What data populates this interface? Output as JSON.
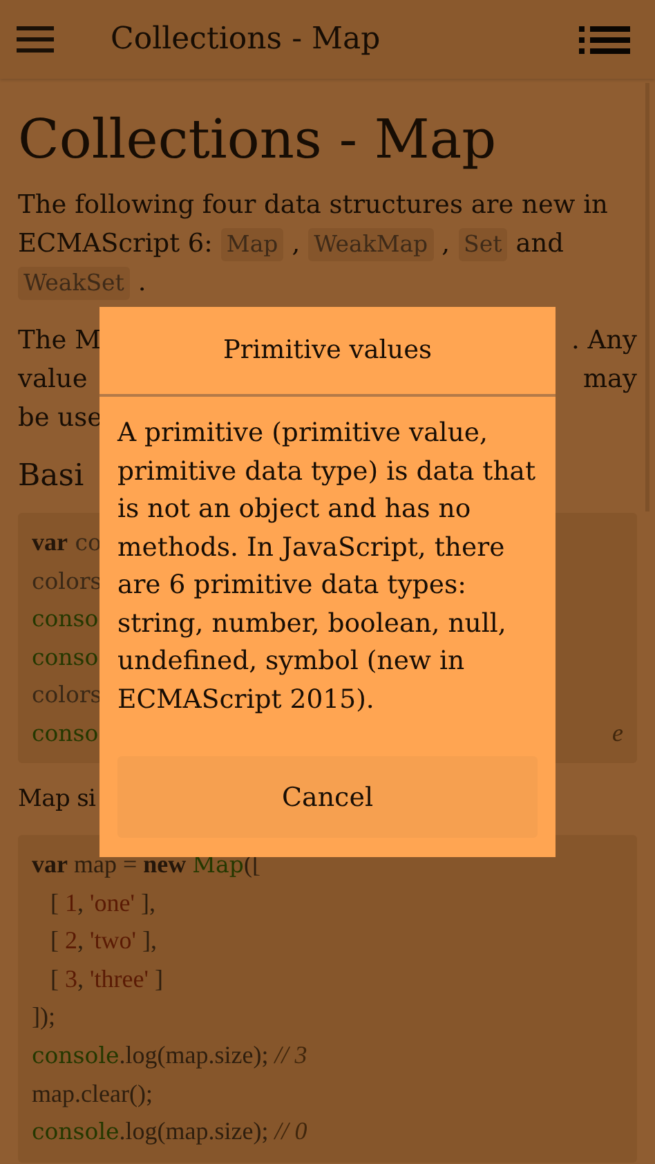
{
  "app_bar": {
    "title": "Collections - Map"
  },
  "page": {
    "title": "Collections - Map",
    "intro_lines": [
      [
        {
          "text": "The following four data structures are new in",
          "kind": "text"
        }
      ],
      [
        {
          "text": "ECMAScript 6:",
          "kind": "text"
        },
        {
          "text": "Map",
          "kind": "code"
        },
        {
          "text": ",",
          "kind": "text"
        },
        {
          "text": "WeakMap",
          "kind": "code"
        },
        {
          "text": ",",
          "kind": "text"
        },
        {
          "text": "Set",
          "kind": "code"
        },
        {
          "text": "and",
          "kind": "text"
        }
      ],
      [
        {
          "text": "WeakSet",
          "kind": "code"
        },
        {
          "text": ".",
          "kind": "text"
        }
      ]
    ],
    "paragraph_lines": [
      {
        "left": "The M",
        "right": ". Any"
      },
      {
        "left": "value",
        "right": "may"
      },
      {
        "left": "be use"
      }
    ],
    "heading": "Basi",
    "code_block_1": [
      {
        "left": [
          {
            "text": "var",
            "kind": "kw"
          },
          {
            "text": " co",
            "kind": "pl"
          }
        ]
      },
      {
        "left": [
          {
            "text": "colors",
            "kind": "pl"
          }
        ]
      },
      {
        "left": [
          {
            "text": "conso",
            "kind": "fn"
          }
        ]
      },
      {
        "left": [
          {
            "text": "conso",
            "kind": "fn"
          }
        ]
      },
      {
        "left": [
          {
            "text": "colors",
            "kind": "pl"
          }
        ]
      },
      {
        "left": [
          {
            "text": "conso",
            "kind": "fn"
          }
        ],
        "right": [
          {
            "text": "e",
            "kind": "cm"
          }
        ]
      }
    ],
    "caption": "Map si",
    "code_block_2": [
      [
        {
          "text": "var",
          "kind": "kw"
        },
        {
          "text": " map = ",
          "kind": "pl"
        },
        {
          "text": "new ",
          "kind": "kw"
        },
        {
          "text": "Map",
          "kind": "fn"
        },
        {
          "text": "([",
          "kind": "pl"
        }
      ],
      [
        {
          "text": "   [ ",
          "kind": "pl"
        },
        {
          "text": "1",
          "kind": "str"
        },
        {
          "text": ", ",
          "kind": "pl"
        },
        {
          "text": "'one'",
          "kind": "str"
        },
        {
          "text": " ],",
          "kind": "pl"
        }
      ],
      [
        {
          "text": "   [ ",
          "kind": "pl"
        },
        {
          "text": "2",
          "kind": "str"
        },
        {
          "text": ", ",
          "kind": "pl"
        },
        {
          "text": "'two'",
          "kind": "str"
        },
        {
          "text": " ],",
          "kind": "pl"
        }
      ],
      [
        {
          "text": "   [ ",
          "kind": "pl"
        },
        {
          "text": "3",
          "kind": "str"
        },
        {
          "text": ", ",
          "kind": "pl"
        },
        {
          "text": "'three'",
          "kind": "str"
        },
        {
          "text": " ]",
          "kind": "pl"
        }
      ],
      [
        {
          "text": "]);",
          "kind": "pl"
        }
      ],
      [
        {
          "text": "console",
          "kind": "fn"
        },
        {
          "text": ".log(map.size); ",
          "kind": "pl"
        },
        {
          "text": "// 3",
          "kind": "cm"
        }
      ],
      [
        {
          "text": "map.clear();",
          "kind": "pl"
        }
      ],
      [
        {
          "text": "console",
          "kind": "fn"
        },
        {
          "text": ".log(map.size); ",
          "kind": "pl"
        },
        {
          "text": "// 0",
          "kind": "cm"
        }
      ]
    ]
  },
  "dialog": {
    "title": "Primitive values",
    "body": "A primitive (primitive value, primitive data type) is data that is not an object and has no methods. In JavaScript, there are 6 primitive data types: string, number, boolean, null, undefined, symbol (new in ECMAScript 2015).",
    "buttons": [
      "Cancel"
    ]
  }
}
